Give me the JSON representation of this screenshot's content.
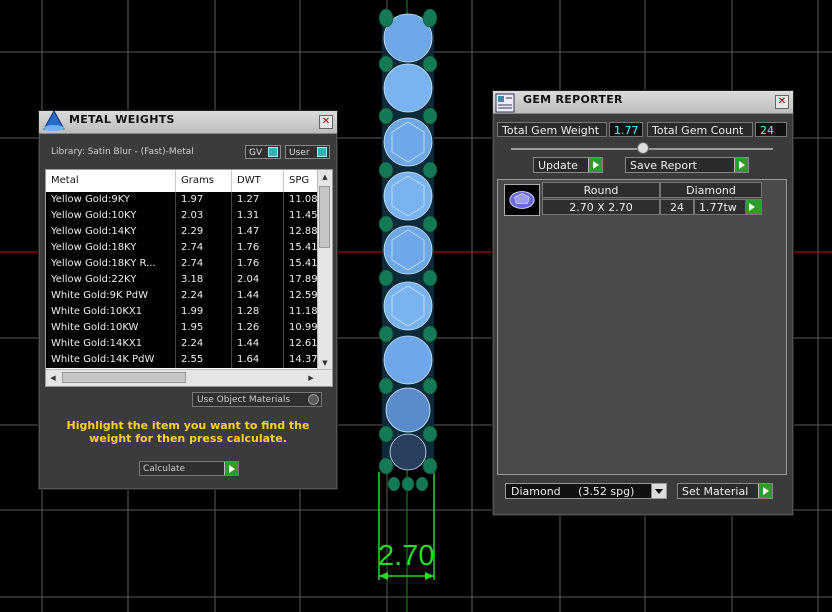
{
  "viewport": {
    "dimension_label": "2.70"
  },
  "metal_weights": {
    "title": "METAL WEIGHTS",
    "library_label": "Library: Satin Blur - (Fast)-Metal",
    "gv_label": "GV",
    "user_label": "User",
    "columns": [
      "Metal",
      "Grams",
      "DWT",
      "SPG"
    ],
    "rows": [
      [
        "Yellow Gold:9KY",
        "1.97",
        "1.27",
        "11.08"
      ],
      [
        "Yellow Gold:10KY",
        "2.03",
        "1.31",
        "11.45"
      ],
      [
        "Yellow Gold:14KY",
        "2.29",
        "1.47",
        "12.88"
      ],
      [
        "Yellow Gold:18KY",
        "2.74",
        "1.76",
        "15.41"
      ],
      [
        "Yellow Gold:18KY R...",
        "2.74",
        "1.76",
        "15.41"
      ],
      [
        "Yellow Gold:22KY",
        "3.18",
        "2.04",
        "17.89"
      ],
      [
        "White Gold:9K PdW",
        "2.24",
        "1.44",
        "12.59"
      ],
      [
        "White Gold:10KX1",
        "1.99",
        "1.28",
        "11.18"
      ],
      [
        "White Gold:10KW",
        "1.95",
        "1.26",
        "10.99"
      ],
      [
        "White Gold:14KX1",
        "2.24",
        "1.44",
        "12.61"
      ],
      [
        "White Gold:14K PdW",
        "2.55",
        "1.64",
        "14.37"
      ]
    ],
    "use_object_materials": "Use Object Materials",
    "hint": "Highlight the item you want to find the weight for then press calculate.",
    "calculate_label": "Calculate"
  },
  "gem_reporter": {
    "title": "GEM REPORTER",
    "total_weight_label": "Total Gem Weight",
    "total_weight_value": "1.77",
    "total_count_label": "Total Gem Count",
    "total_count_value": "24",
    "update_label": "Update",
    "save_label": "Save Report",
    "gem": {
      "shape": "Round",
      "material": "Diamond",
      "size": "2.70 X 2.70",
      "count": "24",
      "weight": "1.77tw"
    },
    "material_select": "Diamond     (3.52 spg)",
    "set_material_label": "Set Material"
  }
}
